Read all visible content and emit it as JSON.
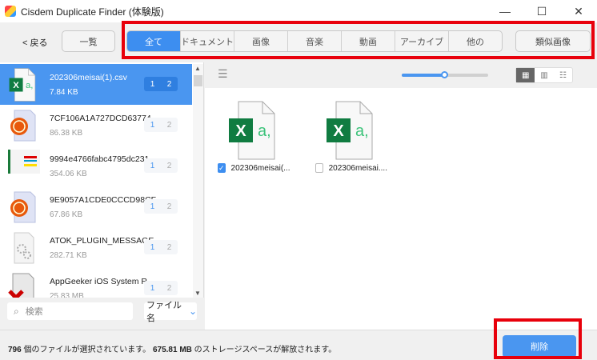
{
  "window": {
    "title": "Cisdem Duplicate Finder (体験版)",
    "minimize": "—",
    "maximize": "☐",
    "close": "✕"
  },
  "toolbar": {
    "back": "< 戻る",
    "list_view": "一覧",
    "similar_images": "類似画像",
    "tabs": [
      {
        "label": "全て",
        "active": true
      },
      {
        "label": "ドキュメント"
      },
      {
        "label": "画像"
      },
      {
        "label": "音楽"
      },
      {
        "label": "動画"
      },
      {
        "label": "アーカイブ"
      },
      {
        "label": "他の"
      }
    ]
  },
  "files": [
    {
      "name": "202306meisai(1).csv",
      "size": "7.84 KB",
      "icon": "excel-csv",
      "selected": true,
      "badge": [
        "1",
        "2"
      ]
    },
    {
      "name": "7CF106A1A727DCD63774...",
      "size": "86.38 KB",
      "icon": "orange-ball-doc",
      "badge": [
        "1",
        "2"
      ]
    },
    {
      "name": "9994e4766fabc4795dc231...",
      "size": "354.06 KB",
      "icon": "image-thumbnail",
      "badge": [
        "1",
        "2"
      ]
    },
    {
      "name": "9E9057A1CDE0CCCD98CF...",
      "size": "67.86 KB",
      "icon": "orange-ball-doc",
      "badge": [
        "1",
        "2"
      ]
    },
    {
      "name": "ATOK_PLUGIN_MESSAGE...",
      "size": "282.71 KB",
      "icon": "gear-doc",
      "badge": [
        "1",
        "2"
      ]
    },
    {
      "name": "AppGeeker iOS System R...",
      "size": "25.83 MB",
      "icon": "broken-doc",
      "badge": [
        "1",
        "2"
      ]
    }
  ],
  "search": {
    "placeholder": "検索",
    "sort": "ファイル名"
  },
  "preview": {
    "zoom_level": 0.49,
    "view_modes": [
      "grid",
      "filmstrip",
      "list"
    ],
    "active_view": "grid",
    "items": [
      {
        "name": "202306meisai(...",
        "checked": true
      },
      {
        "name": "202306meisai....",
        "checked": false
      }
    ]
  },
  "status": {
    "count": "796",
    "count_text": " 個のファイルが選択されています。 ",
    "size": "675.81 MB",
    "size_text": " のストレージスペースが解放されます。"
  },
  "delete_label": "削除",
  "colors": {
    "accent": "#4a96f0",
    "annotation": "#e8000b",
    "excel": "#107c41"
  }
}
